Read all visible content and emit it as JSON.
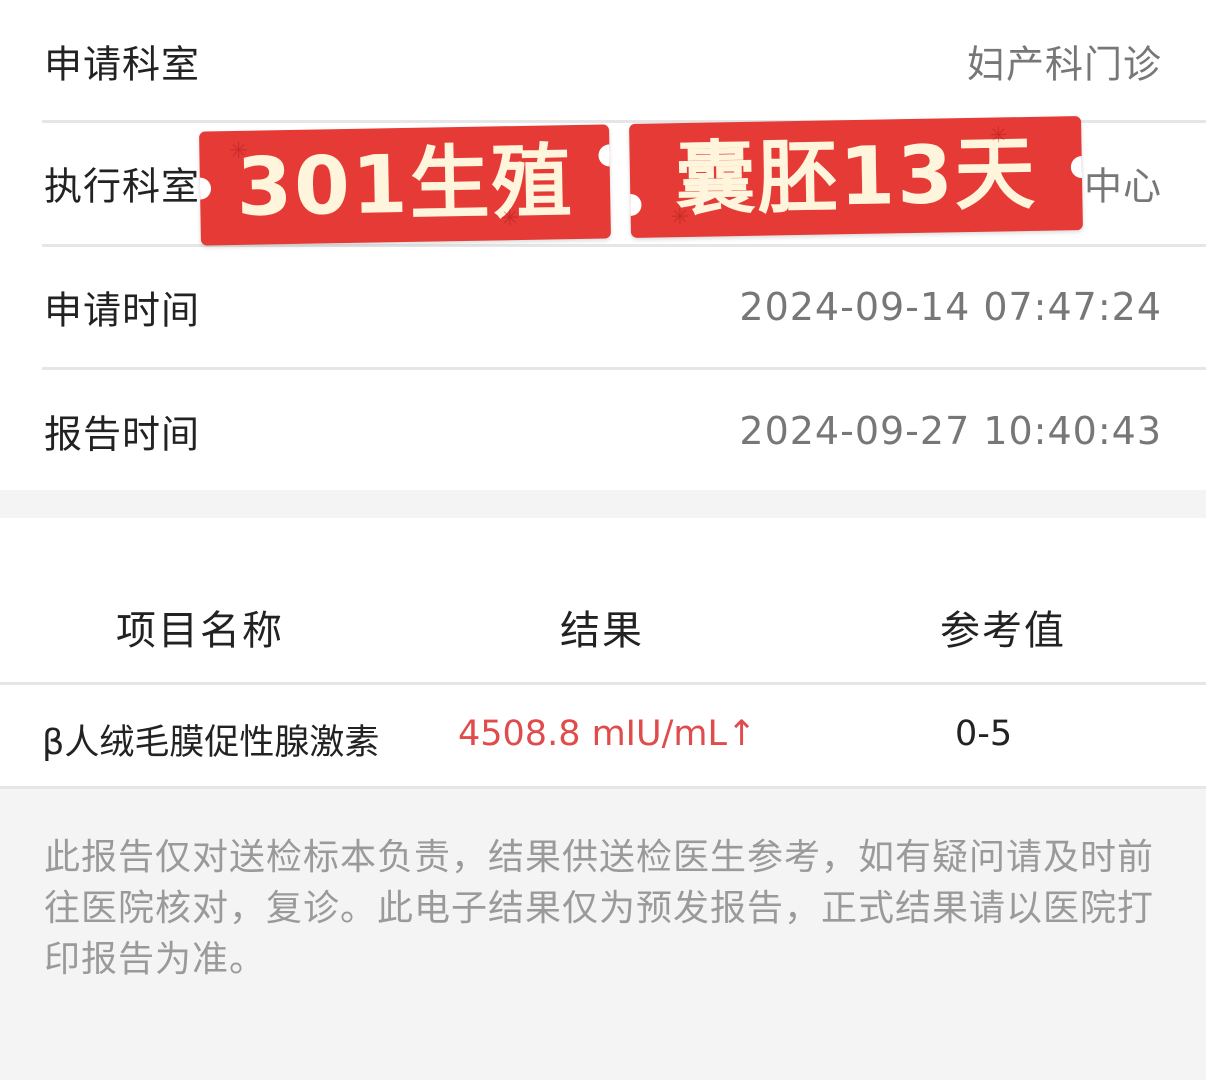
{
  "info": {
    "rows": [
      {
        "label": "申请科室",
        "value": "妇产科门诊"
      },
      {
        "label": "执行科室",
        "value": "中心"
      },
      {
        "label": "申请时间",
        "value": "2024-09-14 07:47:24"
      },
      {
        "label": "报告时间",
        "value": "2024-09-27 10:40:43"
      }
    ]
  },
  "sticker": {
    "part1": "301生殖",
    "part2": "囊胚13天",
    "background_color": "#e53a36",
    "text_color": "#fff5dc"
  },
  "results": {
    "headers": {
      "name": "项目名称",
      "result": "结果",
      "reference": "参考值"
    },
    "rows": [
      {
        "name": "β人绒毛膜促性腺激素",
        "result": "4508.8 mIU/mL↑",
        "reference": "0-5",
        "result_color": "#e04b4b"
      }
    ]
  },
  "disclaimer": "此报告仅对送检标本负责，结果供送检医生参考，如有疑问请及时前往医院核对，复诊。此电子结果仅为预发报告，正式结果请以医院打印报告为准。"
}
